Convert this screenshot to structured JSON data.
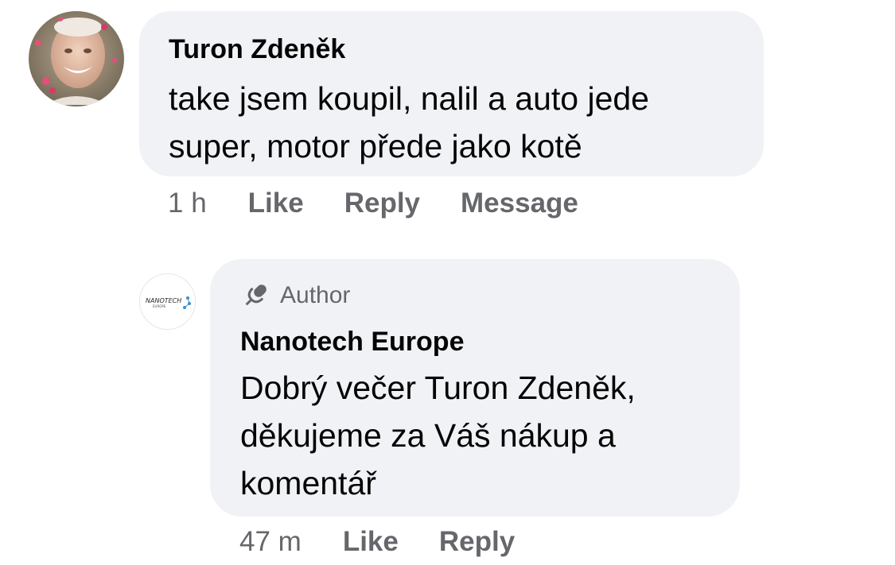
{
  "comments": [
    {
      "author": "Turon Zdeněk",
      "text": "take jsem koupil, nalil a auto jede super, motor přede jako kotě",
      "time": "1 h",
      "actions": [
        "Like",
        "Reply",
        "Message"
      ]
    },
    {
      "badge": "Author",
      "author": "Nanotech Europe",
      "text": "Dobrý večer Turon Zdeněk, děkujeme za Váš nákup a komentář",
      "time": "47 m",
      "actions": [
        "Like",
        "Reply"
      ],
      "avatar_logo": {
        "wordmark": "NANOTECH",
        "tagline": "EUROPE"
      }
    }
  ],
  "colors": {
    "bubble": "#f0f2f5",
    "secondary_text": "#65676b",
    "primary_text": "#050505"
  },
  "icons": {
    "author_badge": "microphone-icon"
  }
}
